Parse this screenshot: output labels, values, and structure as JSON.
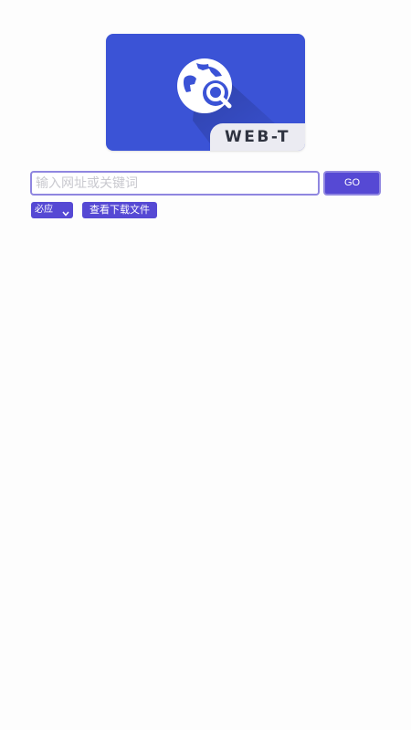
{
  "logo": {
    "tag_text": "WEB-T",
    "card_color": "#3b53d6",
    "icon": "globe-search-icon"
  },
  "search": {
    "placeholder": "输入网址或关键词",
    "value": "",
    "go_label": "GO"
  },
  "engine": {
    "selected": "必应",
    "icon": "chevron-down-icon"
  },
  "downloads": {
    "label": "查看下载文件"
  },
  "colors": {
    "accent": "#5649d4",
    "input_border": "#8f86e0",
    "background": "#fdfdfd"
  }
}
